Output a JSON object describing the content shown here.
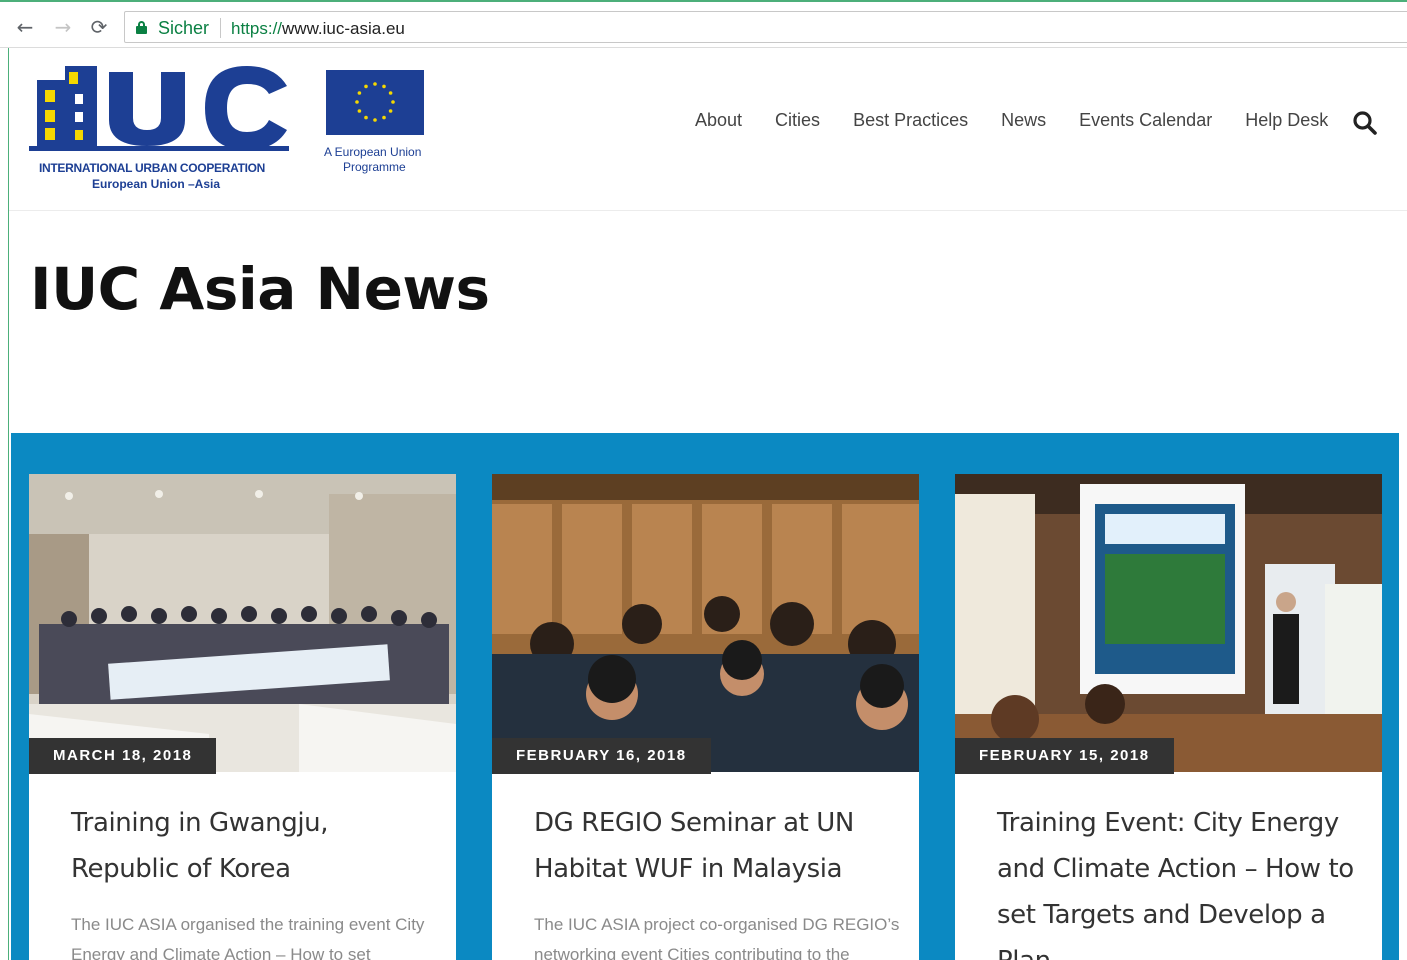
{
  "browser": {
    "secure_label": "Sicher",
    "url_scheme": "https://",
    "url_host": "www.iuc-asia.eu",
    "icons": [
      "back-arrow-icon",
      "forward-arrow-icon",
      "reload-icon",
      "lock-icon"
    ]
  },
  "header": {
    "logo": {
      "letters": "IUC",
      "line1": "INTERNATIONAL URBAN COOPERATION",
      "line2": "European Union –Asia"
    },
    "eu_logo": {
      "caption_line1": "A European Union",
      "caption_line2": "Programme"
    },
    "nav": [
      "About",
      "Cities",
      "Best Practices",
      "News",
      "Events Calendar",
      "Help Desk"
    ]
  },
  "page": {
    "title": "IUC Asia News"
  },
  "colors": {
    "brand_blue": "#1d3f94",
    "band_blue": "#0b89c2",
    "badge_dark": "#333333",
    "secure_green": "#0b8043"
  },
  "posts": [
    {
      "date": "MARCH 18, 2018",
      "title": "Training in Gwangju, Republic of Korea",
      "excerpt": "The IUC ASIA organised the training event City Energy and Climate Action – How to set"
    },
    {
      "date": "FEBRUARY 16, 2018",
      "title": "DG REGIO Seminar at UN Habitat WUF in Malaysia",
      "excerpt": "The IUC ASIA project co-organised DG REGIO’s networking event Cities contributing to the"
    },
    {
      "date": "FEBRUARY 15, 2018",
      "title": "Training Event: City Energy and Climate Action – How to set Targets and Develop a Plan",
      "excerpt": ""
    }
  ]
}
